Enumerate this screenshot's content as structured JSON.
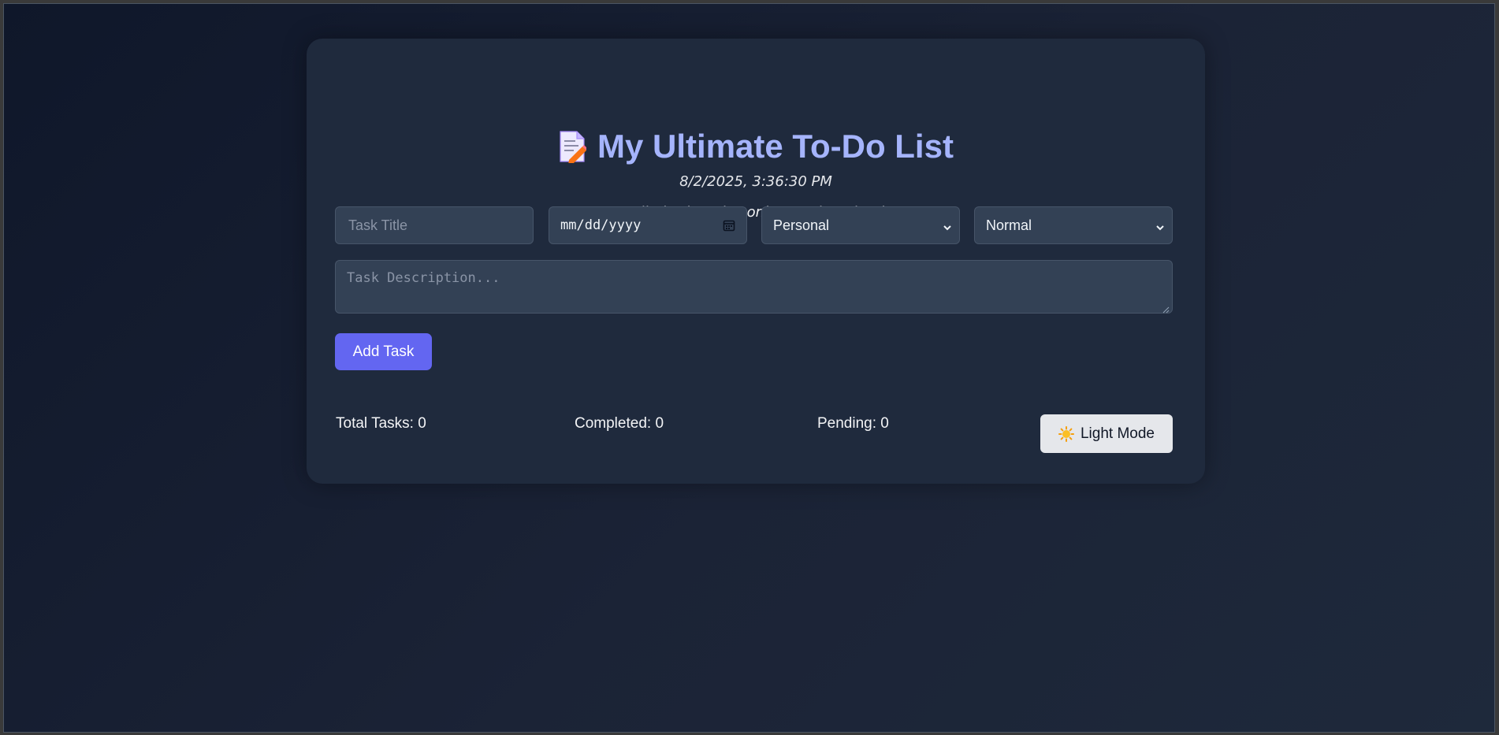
{
  "app": {
    "title": "My Ultimate To-Do List",
    "datetime": "8/2/2025, 3:36:30 PM",
    "quote": "\"Your limitation—it's only your imagination.\""
  },
  "form": {
    "title_placeholder": "Task Title",
    "date_placeholder": "mm/dd/yyyy",
    "category_value": "Personal",
    "priority_value": "Normal",
    "description_placeholder": "Task Description...",
    "add_button_label": "Add Task"
  },
  "stats": {
    "total": "Total Tasks: 0",
    "completed": "Completed: 0",
    "pending": "Pending: 0"
  },
  "theme_toggle": {
    "label": "Light Mode",
    "icon": "sun-icon"
  },
  "colors": {
    "accent": "#6366f1",
    "title": "#a5b4fc",
    "card_bg": "#1f2a3d",
    "page_bg": "#0f172a"
  }
}
